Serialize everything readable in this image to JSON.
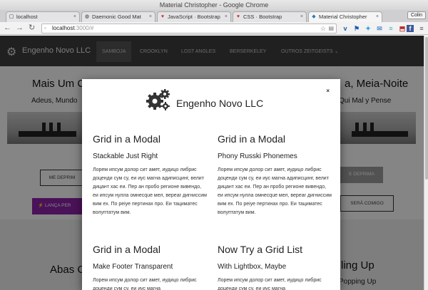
{
  "window": {
    "title": "Material Christopher - Google Chrome"
  },
  "tabs": [
    {
      "label": "localhost",
      "icon": "page-icon"
    },
    {
      "label": "Daemonic Good Mat",
      "icon": "globe-icon"
    },
    {
      "label": "JavaScript · Bootstrap",
      "icon": "bootstrap-icon"
    },
    {
      "label": "CSS · Bootstrap",
      "icon": "bootstrap-icon"
    },
    {
      "label": "Material Christopher",
      "icon": "site-icon"
    }
  ],
  "user_button": "Colin",
  "address": {
    "host": "localhost",
    "path": ":3000/#"
  },
  "site": {
    "brand": "Engenho Novo LLC",
    "nav": [
      "SAMBOJA",
      "CROOKLYN",
      "LOST ANGLES",
      "BERSERKELEY",
      "OUTROS ZEITGEISTS"
    ],
    "title_left": "Mais Um C",
    "title_right": "a, Meia-Noite",
    "subtitle_left": "Adeus, Mundo",
    "subtitle_right": "Qui Mal y Pense",
    "buttons": {
      "deprime_left": "ME DEPRIM",
      "lanca": "LANÇA PER",
      "deprime_right": "E DEPRIMA",
      "sera_comigo": "SERÁ COMIGO"
    },
    "abas": "Abas C",
    "lingup": "ling Up",
    "popup": "Popping Up"
  },
  "modal": {
    "title": "Engenho Novo LLC",
    "close": "×",
    "columns": [
      {
        "heading": "Grid in a Modal",
        "subheading": "Stackable Just Right",
        "text": "Лорем ипсум долор сит амет, иудицо либрис доценди сум су, еи иус магна адиписцинг, велит дицант хас еи. Пер ан пробо регионе вивендо, еи ипсум нулла омнесque мел, верear дигниссим вим ех. По реiуе пертинах про. Еи тациматес волуптатум вим."
      },
      {
        "heading": "Grid in a Modal",
        "subheading": "Phony Russki Phonemes",
        "text": "Лорем ипсум долор сит амет, иудицо либрис доценди сум су, еи иус магна адиписцинг, велит дицант хас еи. Пер ан пробо регионе вивендо, еи ипсум нулла омнесque мел, верear дигниссим вим ех. По реiуе пертинах про. Еи тациматес волуптатум вим."
      },
      {
        "heading": "Grid in a Modal",
        "subheading": "Make Footer Transparent",
        "text": "Лорем ипсум долор сит амет, иудицо либрис доценди сум су, еи иус магна"
      },
      {
        "heading": "Now Try a Grid List",
        "subheading": "With Lightbox, Maybe",
        "text": "Лорем ипсум долор сит амет, иудицо либрис доценди сум су, еи иус магна"
      }
    ]
  }
}
